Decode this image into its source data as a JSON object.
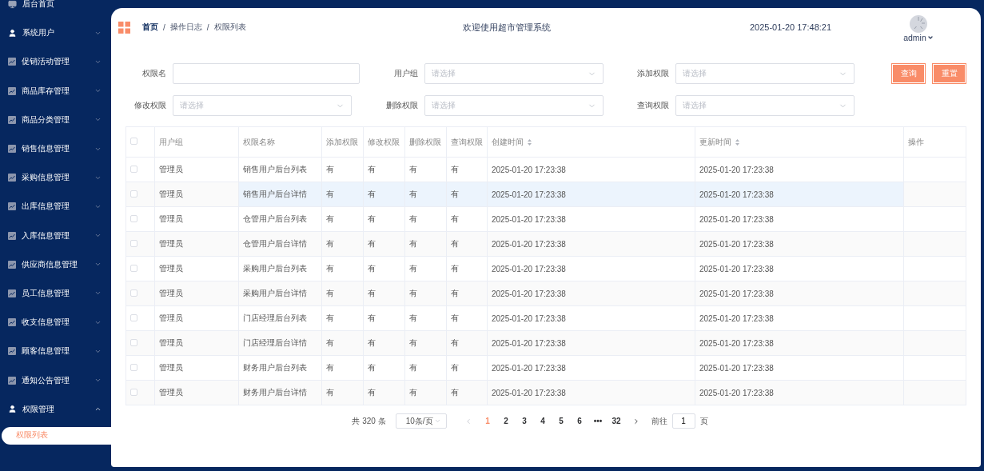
{
  "sidebar": {
    "items": [
      {
        "kind": "home",
        "label": "后台首页"
      },
      {
        "kind": "account",
        "label": "系统用户",
        "expanded": false
      },
      {
        "kind": "module",
        "label": "促销活动管理",
        "expanded": false
      },
      {
        "kind": "module",
        "label": "商品库存管理",
        "expanded": false
      },
      {
        "kind": "module",
        "label": "商品分类管理",
        "expanded": false
      },
      {
        "kind": "module",
        "label": "销售信息管理",
        "expanded": false
      },
      {
        "kind": "module",
        "label": "采购信息管理",
        "expanded": false
      },
      {
        "kind": "module",
        "label": "出库信息管理",
        "expanded": false
      },
      {
        "kind": "module",
        "label": "入库信息管理",
        "expanded": false
      },
      {
        "kind": "module",
        "label": "供应商信息管理",
        "expanded": false
      },
      {
        "kind": "module",
        "label": "员工信息管理",
        "expanded": false
      },
      {
        "kind": "module",
        "label": "收支信息管理",
        "expanded": false
      },
      {
        "kind": "module",
        "label": "顾客信息管理",
        "expanded": false
      },
      {
        "kind": "module",
        "label": "通知公告管理",
        "expanded": false
      },
      {
        "kind": "account",
        "label": "权限管理",
        "expanded": true,
        "children": [
          {
            "label": "权限列表",
            "selected": true
          }
        ]
      }
    ]
  },
  "header": {
    "breadcrumb": [
      "首页",
      "操作日志",
      "权限列表"
    ],
    "separator": "/",
    "title": "欢迎使用超市管理系统",
    "datetime": "2025-01-20 17:48:21",
    "user": "admin"
  },
  "filters": [
    {
      "kind": "text",
      "label": "权限名"
    },
    {
      "kind": "select",
      "label": "用户组",
      "placeholder": "请选择"
    },
    {
      "kind": "select",
      "label": "添加权限",
      "placeholder": "请选择"
    },
    {
      "kind": "select",
      "label": "修改权限",
      "placeholder": "请选择"
    },
    {
      "kind": "select",
      "label": "删除权限",
      "placeholder": "请选择"
    },
    {
      "kind": "select",
      "label": "查询权限",
      "placeholder": "请选择"
    }
  ],
  "buttons": [
    "查询",
    "重置"
  ],
  "table": {
    "all_checked": false,
    "columns": [
      {
        "label": "用户组",
        "kind": "plain"
      },
      {
        "label": "权限名称",
        "kind": "plain"
      },
      {
        "label": "添加权限",
        "kind": "plain"
      },
      {
        "label": "修改权限",
        "kind": "plain"
      },
      {
        "label": "删除权限",
        "kind": "plain"
      },
      {
        "label": "查询权限",
        "kind": "plain"
      },
      {
        "label": "创建时间",
        "kind": "sortable"
      },
      {
        "label": "更新时间",
        "kind": "sortable"
      },
      {
        "label": "操作",
        "kind": "plain"
      }
    ],
    "rows": [
      {
        "checked": false,
        "hovered": false,
        "cells": [
          "管理员",
          "销售用户后台列表",
          "有",
          "有",
          "有",
          "有",
          "2025-01-20 17:23:38",
          "2025-01-20 17:23:38"
        ]
      },
      {
        "checked": false,
        "hovered": true,
        "cells": [
          "管理员",
          "销售用户后台详情",
          "有",
          "有",
          "有",
          "有",
          "2025-01-20 17:23:38",
          "2025-01-20 17:23:38"
        ]
      },
      {
        "checked": false,
        "hovered": false,
        "cells": [
          "管理员",
          "仓管用户后台列表",
          "有",
          "有",
          "有",
          "有",
          "2025-01-20 17:23:38",
          "2025-01-20 17:23:38"
        ]
      },
      {
        "checked": false,
        "hovered": false,
        "cells": [
          "管理员",
          "仓管用户后台详情",
          "有",
          "有",
          "有",
          "有",
          "2025-01-20 17:23:38",
          "2025-01-20 17:23:38"
        ]
      },
      {
        "checked": false,
        "hovered": false,
        "cells": [
          "管理员",
          "采购用户后台列表",
          "有",
          "有",
          "有",
          "有",
          "2025-01-20 17:23:38",
          "2025-01-20 17:23:38"
        ]
      },
      {
        "checked": false,
        "hovered": false,
        "cells": [
          "管理员",
          "采购用户后台详情",
          "有",
          "有",
          "有",
          "有",
          "2025-01-20 17:23:38",
          "2025-01-20 17:23:38"
        ]
      },
      {
        "checked": false,
        "hovered": false,
        "cells": [
          "管理员",
          "门店经理后台列表",
          "有",
          "有",
          "有",
          "有",
          "2025-01-20 17:23:38",
          "2025-01-20 17:23:38"
        ]
      },
      {
        "checked": false,
        "hovered": false,
        "cells": [
          "管理员",
          "门店经理后台详情",
          "有",
          "有",
          "有",
          "有",
          "2025-01-20 17:23:38",
          "2025-01-20 17:23:38"
        ]
      },
      {
        "checked": false,
        "hovered": false,
        "cells": [
          "管理员",
          "财务用户后台列表",
          "有",
          "有",
          "有",
          "有",
          "2025-01-20 17:23:38",
          "2025-01-20 17:23:38"
        ]
      },
      {
        "checked": false,
        "hovered": false,
        "cells": [
          "管理员",
          "财务用户后台详情",
          "有",
          "有",
          "有",
          "有",
          "2025-01-20 17:23:38",
          "2025-01-20 17:23:38"
        ]
      }
    ]
  },
  "pagination": {
    "total": "共 320 条",
    "page_size": "10条/页",
    "pages": [
      {
        "label": "1",
        "selected": true
      },
      {
        "label": "2",
        "selected": false
      },
      {
        "label": "3",
        "selected": false
      },
      {
        "label": "4",
        "selected": false
      },
      {
        "label": "5",
        "selected": false
      },
      {
        "label": "6",
        "selected": false
      },
      {
        "label": "•••",
        "selected": false
      },
      {
        "label": "32",
        "selected": false
      }
    ],
    "goto_label": "前往",
    "goto_value": "1",
    "goto_suffix": "页"
  }
}
